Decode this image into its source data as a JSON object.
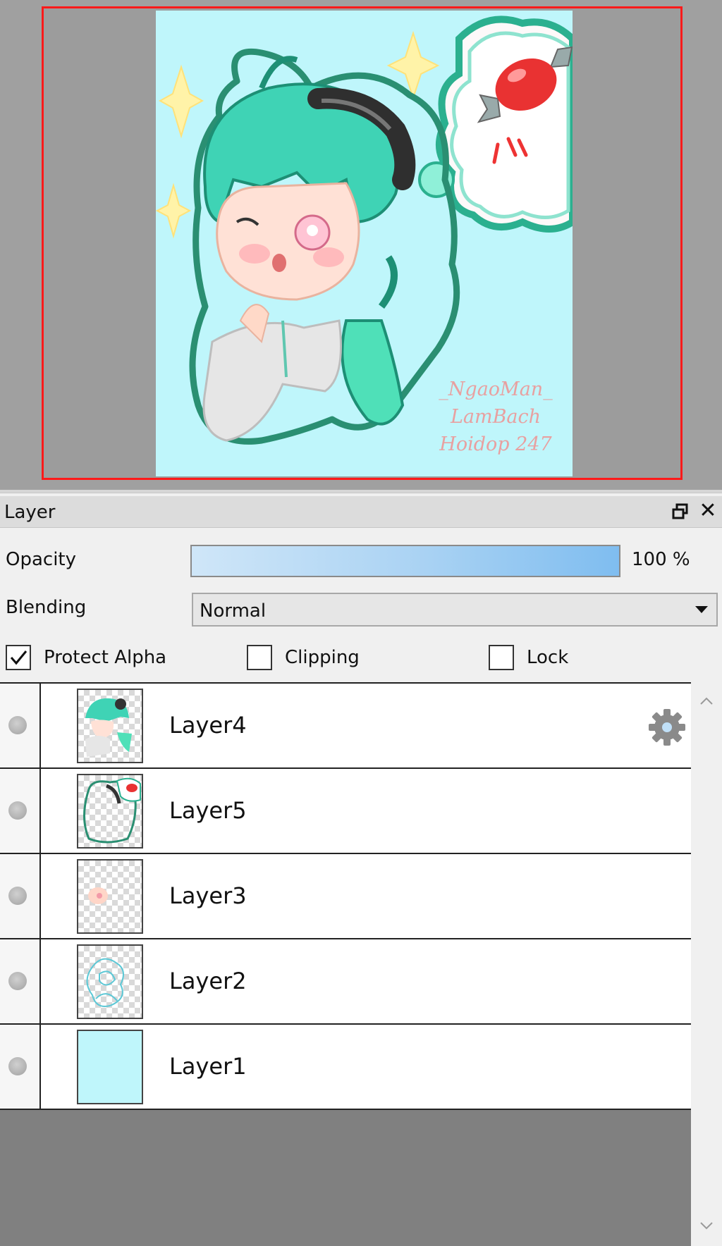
{
  "navigator": {
    "signature_lines": [
      "_NgaoMan_",
      "LamBach",
      "Hoidop 247"
    ]
  },
  "layer_panel": {
    "title": "Layer",
    "float_icon": "float-window-icon",
    "close_glyph": "✕",
    "opacity": {
      "label": "Opacity",
      "value": 100,
      "value_text": "100 %"
    },
    "blending": {
      "label": "Blending",
      "value": "Normal"
    },
    "checkboxes": {
      "protect_alpha": {
        "label": "Protect Alpha",
        "checked": true
      },
      "clipping": {
        "label": "Clipping",
        "checked": false
      },
      "lock": {
        "label": "Lock",
        "checked": false
      }
    },
    "layers": [
      {
        "name": "Layer4",
        "selected": true
      },
      {
        "name": "Layer5",
        "selected": false
      },
      {
        "name": "Layer3",
        "selected": false
      },
      {
        "name": "Layer2",
        "selected": false
      },
      {
        "name": "Layer1",
        "selected": false
      }
    ]
  },
  "colors": {
    "selection": "#c0e0f8",
    "canvas_bg": "#bff6fb",
    "nav_frame": "#ff1a1a"
  }
}
